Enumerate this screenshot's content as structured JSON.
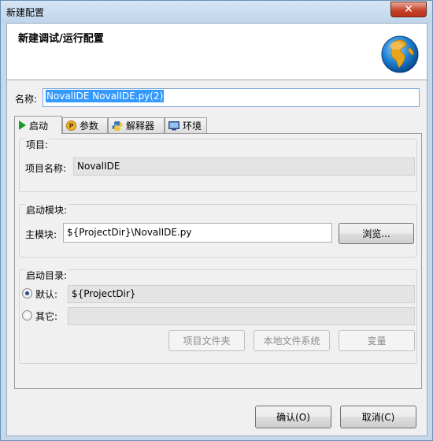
{
  "window": {
    "title": "新建配置",
    "close_glyph": "✕"
  },
  "header": {
    "title": "新建调试/运行配置",
    "icon": "globe-icon"
  },
  "name": {
    "label": "名称:",
    "value": "NovalIDE NovalIDE.py(2)"
  },
  "tabs": [
    {
      "label": "启动",
      "icon": "play-icon",
      "active": true
    },
    {
      "label": "参数",
      "icon": "parameter-icon",
      "active": false
    },
    {
      "label": "解释器",
      "icon": "python-icon",
      "active": false
    },
    {
      "label": "环境",
      "icon": "environment-icon",
      "active": false
    }
  ],
  "project": {
    "group_label": "项目:",
    "field_label": "项目名称:",
    "value": "NovalIDE"
  },
  "module": {
    "group_label": "启动模块:",
    "field_label": "主模块:",
    "value": "${ProjectDir}\\NovalIDE.py",
    "browse_label": "浏览..."
  },
  "directory": {
    "group_label": "启动目录:",
    "default_label": "默认:",
    "default_value": "${ProjectDir}",
    "other_label": "其它:",
    "other_value": "",
    "project_folder_label": "项目文件夹",
    "local_fs_label": "本地文件系统",
    "variable_label": "变量"
  },
  "footer": {
    "ok_label": "确认(O)",
    "cancel_label": "取消(C)"
  },
  "colors": {
    "accent": "#3399ff",
    "play_green": "#1e9a27"
  }
}
